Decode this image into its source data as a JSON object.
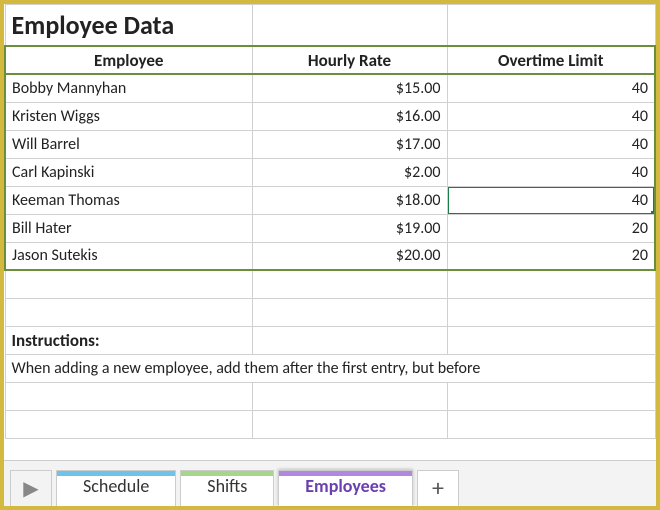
{
  "title": "Employee Data",
  "columns": {
    "employee": "Employee",
    "hourly_rate": "Hourly Rate",
    "overtime_limit": "Overtime Limit"
  },
  "rows": [
    {
      "name": "Bobby Mannyhan",
      "rate": "$15.00",
      "ot": "40"
    },
    {
      "name": "Kristen Wiggs",
      "rate": "$16.00",
      "ot": "40"
    },
    {
      "name": "Will Barrel",
      "rate": "$17.00",
      "ot": "40"
    },
    {
      "name": "Carl Kapinski",
      "rate": "$2.00",
      "ot": "40"
    },
    {
      "name": "Keeman Thomas",
      "rate": "$18.00",
      "ot": "40"
    },
    {
      "name": "Bill Hater",
      "rate": "$19.00",
      "ot": "20"
    },
    {
      "name": "Jason Sutekis",
      "rate": "$20.00",
      "ot": "20"
    }
  ],
  "selected_row_index": 4,
  "selected_col": "ot",
  "instructions": {
    "label": "Instructions:",
    "text": "When adding a new employee, add them after the first entry, but before"
  },
  "tabs": {
    "schedule": "Schedule",
    "shifts": "Shifts",
    "employees": "Employees",
    "active": "employees"
  },
  "icons": {
    "nav_next": "▶",
    "add_sheet": "+"
  }
}
